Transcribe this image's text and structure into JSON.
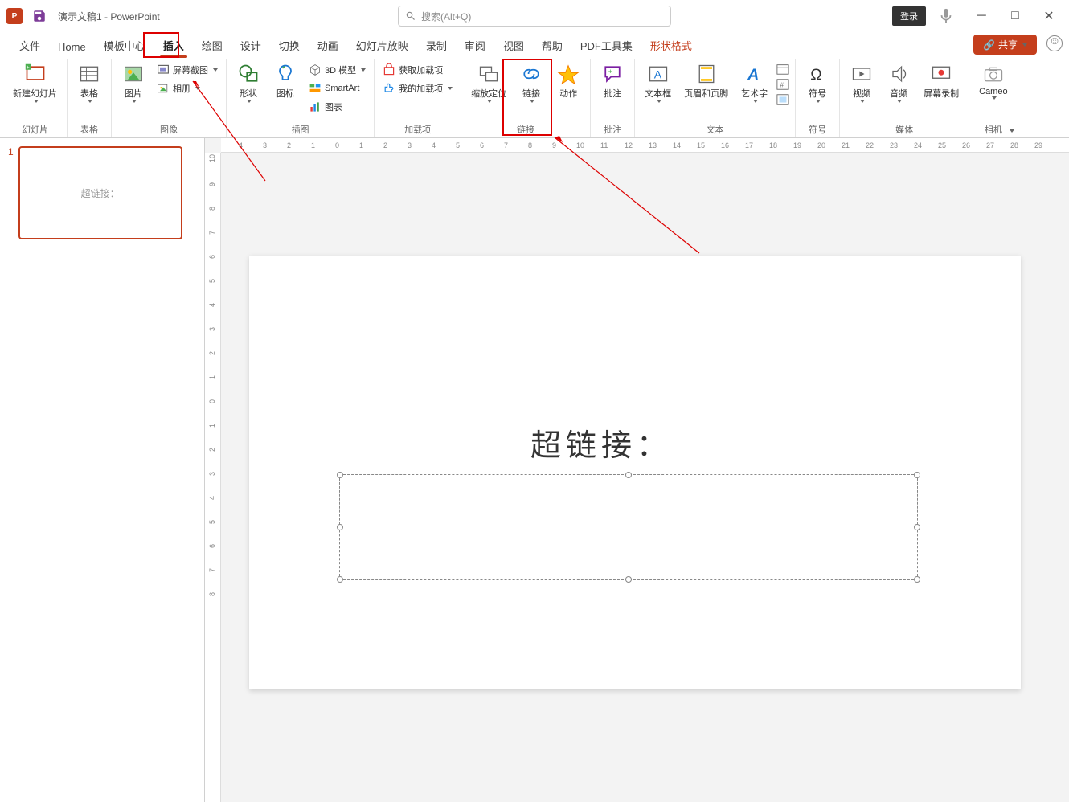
{
  "title": {
    "doc": "演示文稿1",
    "app": "PowerPoint",
    "sep": " - "
  },
  "search": {
    "placeholder": "搜索(Alt+Q)"
  },
  "login": "登录",
  "tabs": {
    "file": "文件",
    "home": "Home",
    "template": "模板中心",
    "insert": "插入",
    "draw": "绘图",
    "design": "设计",
    "transition": "切换",
    "anim": "动画",
    "slideshow": "幻灯片放映",
    "record": "录制",
    "review": "审阅",
    "view": "视图",
    "help": "帮助",
    "pdf": "PDF工具集",
    "shapefmt": "形状格式"
  },
  "share": "共享",
  "ribbon": {
    "group_slide": "幻灯片",
    "new_slide": "新建幻灯片",
    "group_table": "表格",
    "table": "表格",
    "group_image": "图像",
    "pictures": "图片",
    "screenshot": "屏幕截图",
    "album": "相册",
    "group_illus": "插图",
    "shapes": "形状",
    "icons": "图标",
    "model3d": "3D 模型",
    "smartart": "SmartArt",
    "chart": "图表",
    "group_addins": "加载项",
    "get_addins": "获取加载项",
    "my_addins": "我的加载项",
    "group_link": "链接",
    "zoom": "缩放定位",
    "link": "链接",
    "action": "动作",
    "group_comment": "批注",
    "comment": "批注",
    "group_text": "文本",
    "textbox": "文本框",
    "headerfooter": "页眉和页脚",
    "wordart": "艺术字",
    "group_symbol": "符号",
    "symbol": "符号",
    "group_media": "媒体",
    "video": "视频",
    "audio": "音频",
    "screenrec": "屏幕录制",
    "group_camera": "相机",
    "cameo": "Cameo"
  },
  "slide": {
    "num": "1",
    "thumb_text": "超链接：",
    "title_text": "超链接："
  }
}
